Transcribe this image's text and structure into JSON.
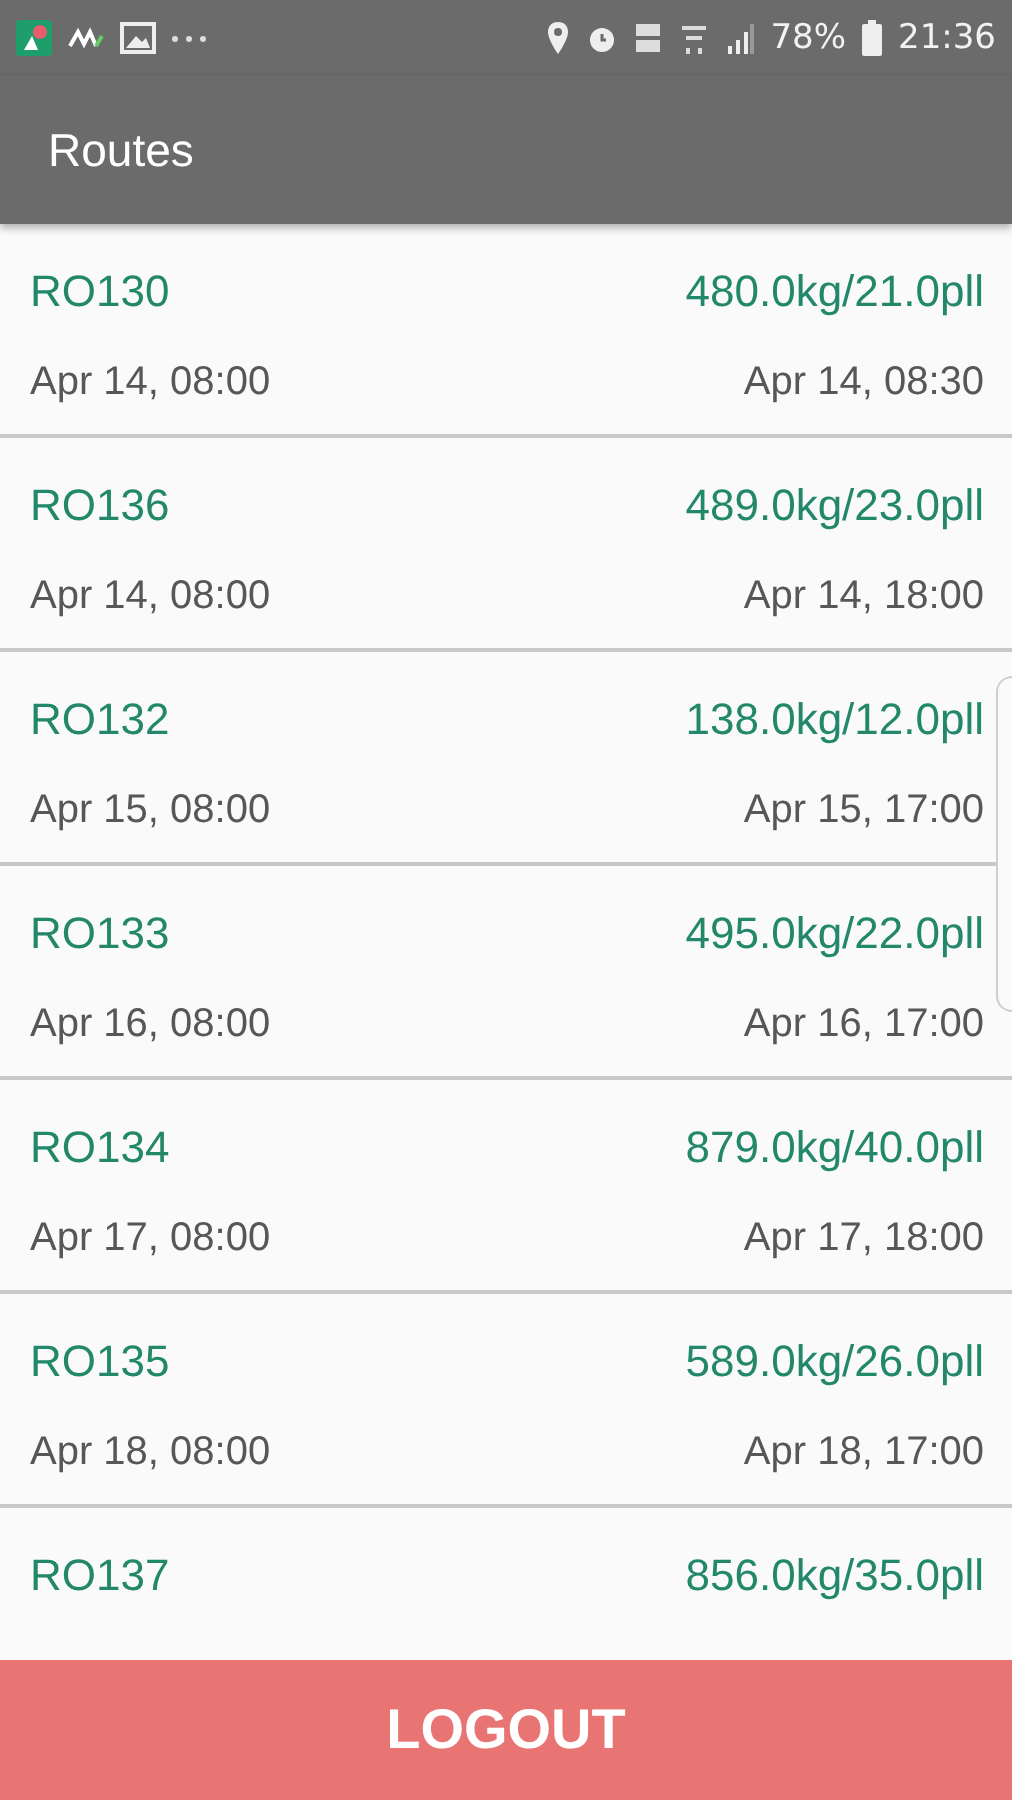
{
  "status_bar": {
    "battery": "78%",
    "time": "21:36"
  },
  "app_bar": {
    "title": "Routes"
  },
  "routes": [
    {
      "code": "RO130",
      "load": "480.0kg/21.0pll",
      "start": "Apr 14, 08:00",
      "end": "Apr 14, 08:30"
    },
    {
      "code": "RO136",
      "load": "489.0kg/23.0pll",
      "start": "Apr 14, 08:00",
      "end": "Apr 14, 18:00"
    },
    {
      "code": "RO132",
      "load": "138.0kg/12.0pll",
      "start": "Apr 15, 08:00",
      "end": "Apr 15, 17:00"
    },
    {
      "code": "RO133",
      "load": "495.0kg/22.0pll",
      "start": "Apr 16, 08:00",
      "end": "Apr 16, 17:00"
    },
    {
      "code": "RO134",
      "load": "879.0kg/40.0pll",
      "start": "Apr 17, 08:00",
      "end": "Apr 17, 18:00"
    },
    {
      "code": "RO135",
      "load": "589.0kg/26.0pll",
      "start": "Apr 18, 08:00",
      "end": "Apr 18, 17:00"
    },
    {
      "code": "RO137",
      "load": "856.0kg/35.0pll"
    }
  ],
  "logout_button": {
    "label": "LOGOUT"
  }
}
